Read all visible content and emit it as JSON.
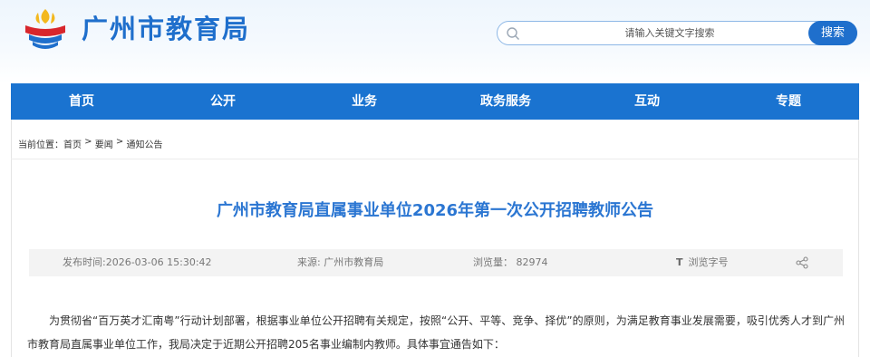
{
  "site": {
    "title": "广州市教育局"
  },
  "search": {
    "placeholder": "请输入关键文字搜索",
    "button_label": "搜索"
  },
  "nav": {
    "items": [
      {
        "label": "首页"
      },
      {
        "label": "公开"
      },
      {
        "label": "业务"
      },
      {
        "label": "政务服务"
      },
      {
        "label": "互动"
      },
      {
        "label": "专题"
      }
    ]
  },
  "breadcrumb": {
    "prefix": "当前位置：",
    "items": [
      "首页",
      "要闻",
      "通知公告"
    ],
    "separator": " > "
  },
  "article": {
    "title": "广州市教育局直属事业单位2026年第一次公开招聘教师公告",
    "publish_time": "发布时间:2026-03-06 15:30:42",
    "source": "来源: 广州市教育局",
    "views": "浏览量： 82974",
    "font_size_label": "浏览字号",
    "font_size_icon": "T",
    "body": "为贯彻省“百万英才汇南粤”行动计划部署，根据事业单位公开招聘有关规定，按照“公开、平等、竞争、择优”的原则，为满足教育事业发展需要，吸引优秀人才到广州市教育局直属事业单位工作，我局决定于近期公开招聘205名事业编制内教师。具体事宜通告如下："
  },
  "colors": {
    "brand_blue": "#1f6fcc",
    "nav_blue": "#1a73d0",
    "title_blue": "#2b76d2",
    "logo_red": "#d8262c",
    "logo_gold": "#f3b81e"
  },
  "icons": {
    "logo": "education-bureau-emblem",
    "search": "search-icon",
    "share": "share-icon"
  }
}
